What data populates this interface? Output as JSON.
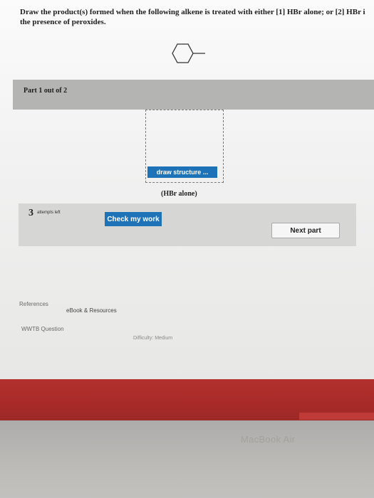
{
  "question": {
    "line1": "Draw the product(s) formed when the following alkene is treated with either [1] HBr alone; or [2] HBr i",
    "line2": "the presence of peroxides."
  },
  "part": {
    "label": "Part 1 out of 2"
  },
  "draw": {
    "button_label": "draw structure ...",
    "condition": "(HBr alone)"
  },
  "attempts": {
    "count": "3",
    "text": "attempts left"
  },
  "buttons": {
    "check": "Check my work",
    "next": "Next part"
  },
  "links": {
    "references": "References",
    "ebook": "eBook & Resources",
    "wwtb": "WWTB Question"
  },
  "difficulty": "Difficulty: Medium",
  "device": {
    "brand": "MacBook Air"
  },
  "colors": {
    "accent": "#1d72b8",
    "bezel": "#a82a28"
  },
  "icons": {
    "molecule": "methylenecyclohexane-structure-icon"
  }
}
